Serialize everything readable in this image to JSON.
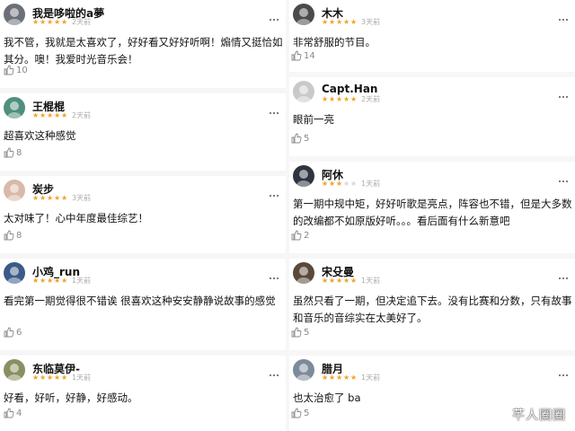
{
  "left": [
    {
      "user": "我是哆啦的a夢",
      "stars": 5,
      "time": "2天前",
      "text": "我不管，我就是太喜欢了，好好看又好好听啊！煽情又挺恰如其分。噢！我爱时光音乐会！",
      "likes": "10"
    },
    {
      "user": "王棍棍",
      "stars": 5,
      "time": "2天前",
      "text": "超喜欢这种感觉",
      "likes": "8"
    },
    {
      "user": "炭步",
      "stars": 5,
      "time": "3天前",
      "text": "太对味了！心中年度最佳综艺！",
      "likes": "8"
    },
    {
      "user": "小鸡_run",
      "stars": 5,
      "time": "1天前",
      "text": "看完第一期觉得很不错诶 很喜欢这种安安静静说故事的感觉",
      "likes": "6"
    },
    {
      "user": "东临莫伊-",
      "stars": 5,
      "time": "1天前",
      "text": "好看，好听，好静，好感动。",
      "likes": "4"
    }
  ],
  "right": [
    {
      "user": "木木",
      "stars": 5,
      "time": "3天前",
      "text": "非常舒服的节目。",
      "likes": "14"
    },
    {
      "user": "Capt.Han",
      "stars": 5,
      "time": "2天前",
      "text": "眼前一亮",
      "likes": "5"
    },
    {
      "user": "阿休",
      "stars": 3,
      "time": "1天前",
      "text": "第一期中规中矩，好好听歌是亮点，阵容也不错，但是大多数的改编都不如原版好听。。。看后面有什么新意吧",
      "likes": "2"
    },
    {
      "user": "宋殳曼",
      "stars": 5,
      "time": "1天前",
      "text": "虽然只看了一期，但决定追下去。没有比赛和分数，只有故事和音乐的音综实在太美好了。",
      "likes": "5"
    },
    {
      "user": "腊月",
      "stars": 5,
      "time": "1天前",
      "text": "也太治愈了 ba",
      "likes": "5"
    }
  ],
  "watermark": "芊人圈圈",
  "colors": {
    "star_on": "#f2a127",
    "star_off": "#d7d7d7",
    "time": "#aaaaaa",
    "likes": "#888888"
  }
}
